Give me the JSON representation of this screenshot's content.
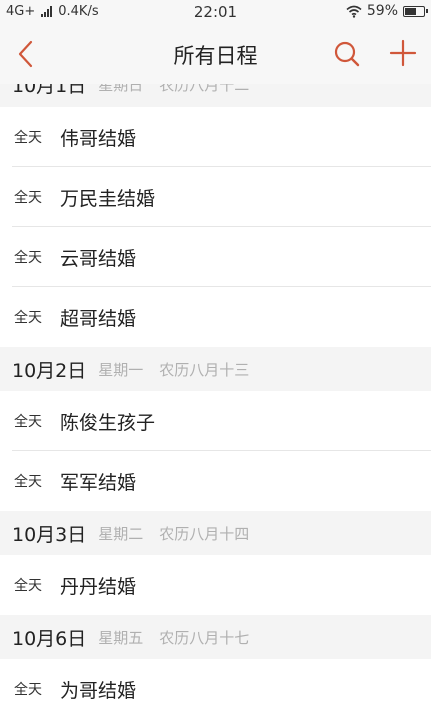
{
  "status": {
    "network": "4G+",
    "speed": "0.4K/s",
    "time": "22:01",
    "battery": "59%",
    "battery_level": 0.59
  },
  "nav": {
    "title": "所有日程",
    "accent": "#d0573a"
  },
  "groups": [
    {
      "date": "10月1日",
      "weekday": "星期日",
      "lunar": "农历八月十二",
      "events": [
        {
          "allday": "全天",
          "title": "伟哥结婚"
        },
        {
          "allday": "全天",
          "title": "万民圭结婚"
        },
        {
          "allday": "全天",
          "title": "云哥结婚"
        },
        {
          "allday": "全天",
          "title": "超哥结婚"
        }
      ]
    },
    {
      "date": "10月2日",
      "weekday": "星期一",
      "lunar": "农历八月十三",
      "events": [
        {
          "allday": "全天",
          "title": "陈俊生孩子"
        },
        {
          "allday": "全天",
          "title": "军军结婚"
        }
      ]
    },
    {
      "date": "10月3日",
      "weekday": "星期二",
      "lunar": "农历八月十四",
      "events": [
        {
          "allday": "全天",
          "title": "丹丹结婚"
        }
      ]
    },
    {
      "date": "10月6日",
      "weekday": "星期五",
      "lunar": "农历八月十七",
      "events": [
        {
          "allday": "全天",
          "title": "为哥结婚"
        }
      ]
    }
  ]
}
